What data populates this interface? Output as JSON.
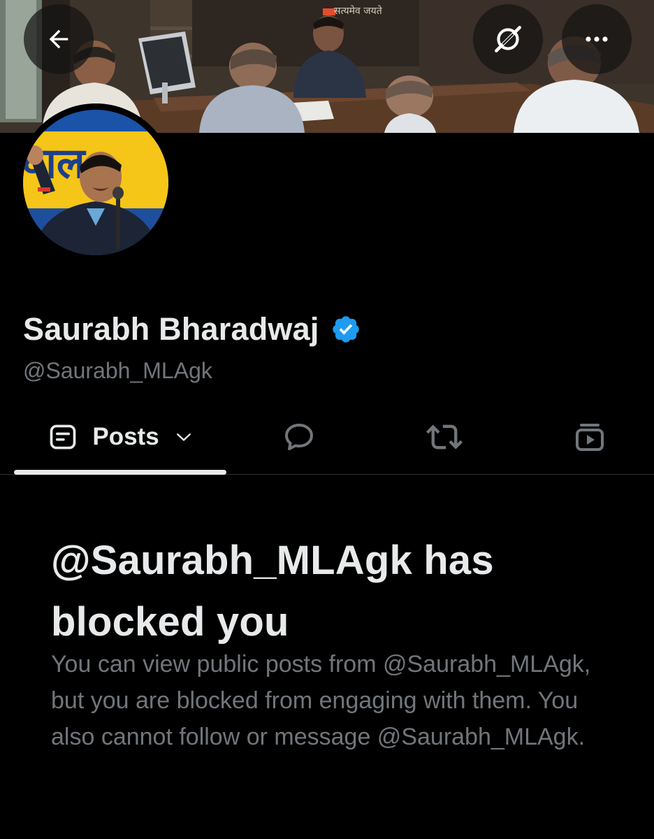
{
  "header": {
    "back_icon": "arrow-left-icon",
    "grok_icon": "grok-icon",
    "more_icon": "more-horizontal-icon",
    "banner_text": "सत्यमेव जयते"
  },
  "profile": {
    "display_name": "Saurabh Bharadwaj",
    "handle": "@Saurabh_MLAgk",
    "verified": true,
    "verified_color": "#1d9bf0",
    "avatar_sign_text": "वाल"
  },
  "tabs": [
    {
      "icon": "posts-icon",
      "label": "Posts",
      "selected": true,
      "has_dropdown": true
    },
    {
      "icon": "reply-bubble-icon",
      "label": ""
    },
    {
      "icon": "repost-icon",
      "label": ""
    },
    {
      "icon": "video-icon",
      "label": ""
    }
  ],
  "blocked": {
    "title": "@Saurabh_MLAgk has blocked you",
    "body": "You can view public posts from @Saurabh_MLAgk, but you are blocked from engaging with them. You also cannot follow or message @Saurabh_MLAgk."
  },
  "colors": {
    "background": "#000000",
    "primary_text": "#e7e9ea",
    "secondary_text": "#71767b",
    "divider": "#2f3336",
    "accent": "#1d9bf0"
  }
}
